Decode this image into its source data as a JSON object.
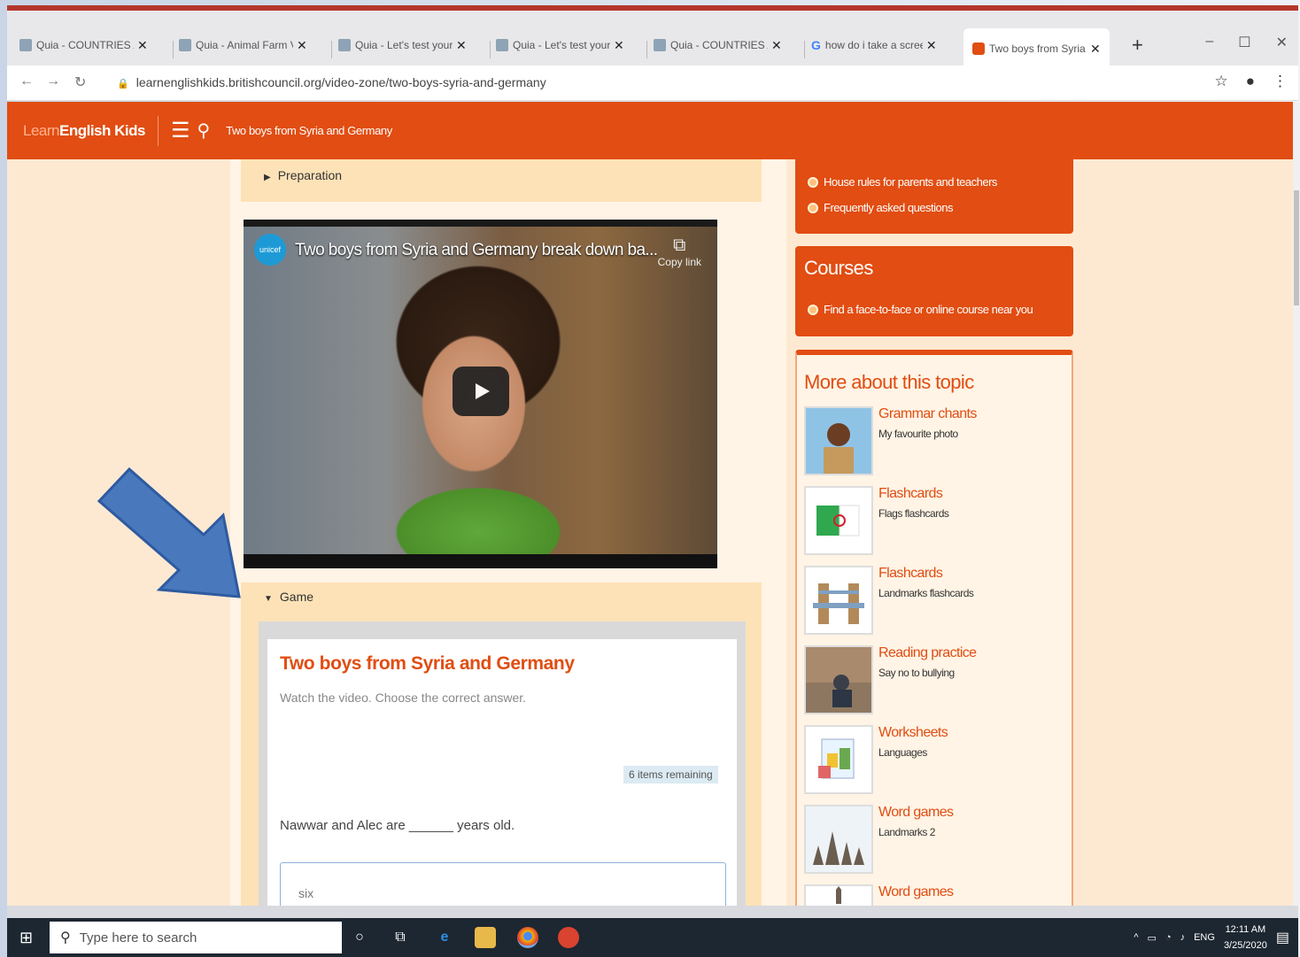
{
  "browser": {
    "tabs": [
      {
        "label": "Quia - COUNTRIES AN",
        "favicon": "quia-icon"
      },
      {
        "label": "Quia - Animal Farm V",
        "favicon": "quia-icon"
      },
      {
        "label": "Quia - Let's test your",
        "favicon": "quia-icon"
      },
      {
        "label": "Quia - Let's test your",
        "favicon": "quia-icon"
      },
      {
        "label": "Quia - COUNTRIES AN",
        "favicon": "quia-icon"
      },
      {
        "label": "how do i take a scree",
        "favicon": "google-icon"
      },
      {
        "label": "Two boys from Syria a",
        "favicon": "learnenglishkids-icon"
      }
    ],
    "url": "learnenglishkids.britishcouncil.org/video-zone/two-boys-syria-and-germany"
  },
  "site": {
    "logo_learn": "Learn",
    "logo_english_kids": "English Kids",
    "page_title": "Two boys from Syria and Germany"
  },
  "main": {
    "preparation_label": "Preparation",
    "video": {
      "title": "Two boys from Syria and Germany break down ba...",
      "copy_link": "Copy link",
      "channel_logo": "unicef"
    },
    "game": {
      "label": "Game",
      "title": "Two boys from Syria and Germany",
      "instruction": "Watch the video. Choose the correct answer.",
      "items_remaining": "6 items remaining",
      "question": "Nawwar and Alec are ______ years old.",
      "answer_option": "six"
    }
  },
  "sidebar": {
    "links": [
      "House rules for parents and teachers",
      "Frequently asked questions"
    ],
    "courses": {
      "heading": "Courses",
      "link": "Find a face-to-face or online course near you"
    },
    "more": {
      "heading": "More about this topic",
      "items": [
        {
          "category": "Grammar chants",
          "title": "My favourite photo"
        },
        {
          "category": "Flashcards",
          "title": "Flags flashcards"
        },
        {
          "category": "Flashcards",
          "title": "Landmarks flashcards"
        },
        {
          "category": "Reading practice",
          "title": "Say no to bullying"
        },
        {
          "category": "Worksheets",
          "title": "Languages"
        },
        {
          "category": "Word games",
          "title": "Landmarks 2"
        },
        {
          "category": "Word games",
          "title": ""
        }
      ]
    }
  },
  "taskbar": {
    "search_placeholder": "Type here to search",
    "language": "ENG",
    "time": "12:11 AM",
    "date": "3/25/2020"
  },
  "colors": {
    "brand": "#e14d12",
    "page_bg": "#fde9d2",
    "annotation_arrow": "#4a78bd"
  }
}
